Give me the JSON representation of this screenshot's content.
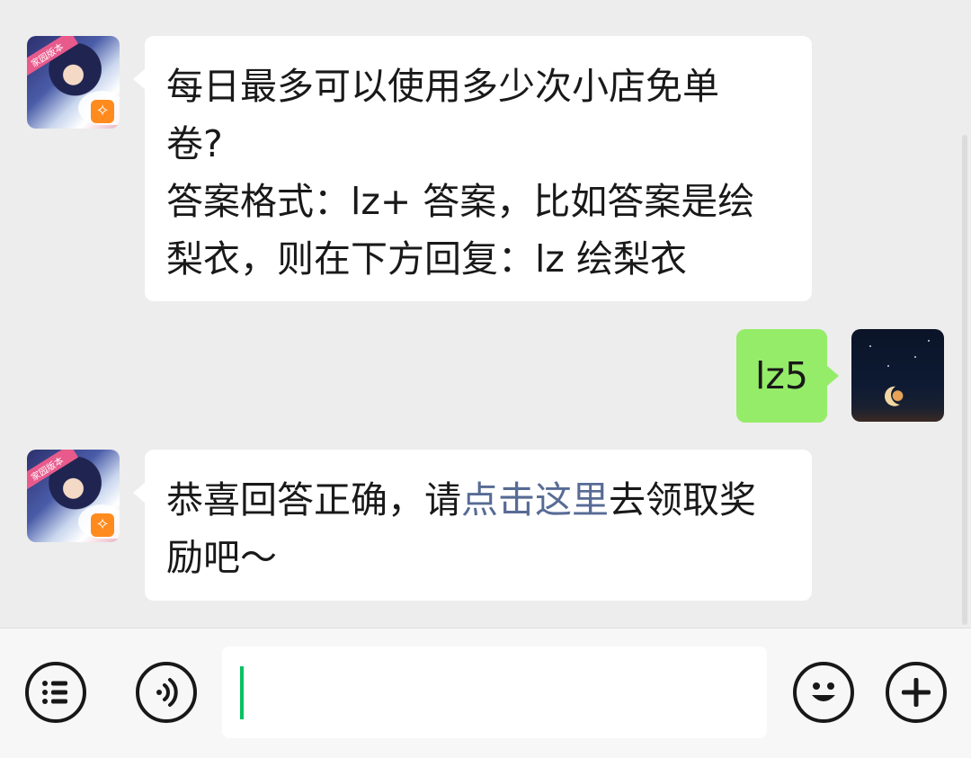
{
  "messages": [
    {
      "sender": "game-account",
      "avatar_badge": "家园版本",
      "lines": [
        "每日最多可以使用多少次小店免单",
        "卷?",
        "答案格式：lz+ 答案，比如答案是绘",
        "梨衣，则在下方回复：lz 绘梨衣"
      ]
    },
    {
      "sender": "self",
      "text": "lz5"
    },
    {
      "sender": "game-account",
      "avatar_badge": "家园版本",
      "prefix": "恭喜回答正确，请",
      "link": "点击这里",
      "suffix_line1": "去领取奖",
      "line2": "励吧～"
    }
  ],
  "toolbar": {
    "left_icons": [
      "menu-list-icon",
      "voice-icon"
    ],
    "right_icons": [
      "emoji-icon",
      "plus-icon"
    ],
    "input_value": ""
  },
  "colors": {
    "chat_bg": "#ededed",
    "self_bubble": "#95ec69",
    "link": "#576b95",
    "caret": "#07c160"
  }
}
